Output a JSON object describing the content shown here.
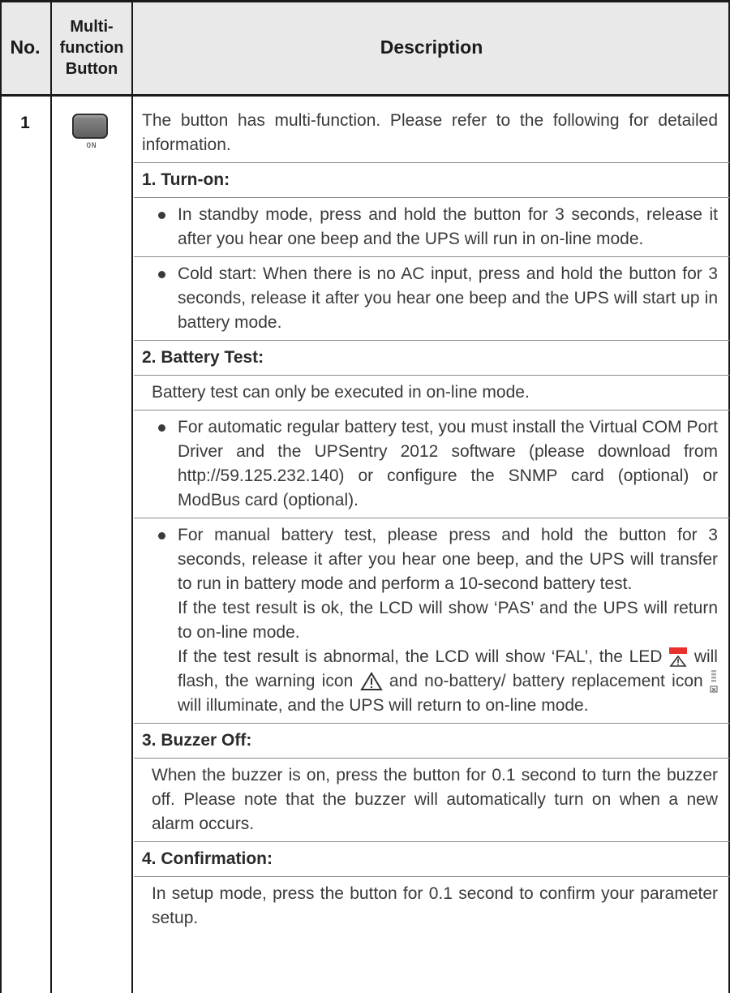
{
  "header": {
    "no": "No.",
    "button_line1": "Multi-",
    "button_line2": "function",
    "button_line3": "Button",
    "description": "Description"
  },
  "row": {
    "no": "1",
    "button_label": "ON",
    "intro": "The button has multi-function. Please refer to the following for detailed information.",
    "turn_on": {
      "heading": "1. Turn-on:",
      "bullets": [
        "In standby mode, press and hold the button for 3 seconds, release it after you hear one beep and the UPS will run in on-line mode.",
        "Cold start: When there is no AC input, press and hold the button for 3 seconds, release it after you hear one beep and the UPS will start up in battery mode."
      ]
    },
    "battery_test": {
      "heading": "2. Battery Test:",
      "intro": "Battery test can only be executed in on-line mode.",
      "bullets": [
        "For automatic regular battery test, you must install the Virtual COM Port Driver and the UPSentry 2012 software (please download from http://59.125.232.140) or configure the SNMP card (optional) or ModBus card (optional).",
        "For manual battery test, please press and hold the button for 3 seconds, release it after you hear one beep, and the UPS will transfer to run in battery mode and perform a 10-second battery test."
      ],
      "result_ok": "If the test result is ok, the LCD will show ‘PAS’ and the UPS will return to on-line mode.",
      "result_abnormal_1": "If the test result is abnormal, the LCD will show ‘FAL’, the LED",
      "result_abnormal_2": "will flash, the warning icon",
      "result_abnormal_3": "and no-battery/ battery replacement icon",
      "result_abnormal_4": "will illuminate, and the UPS will return to on-line mode."
    },
    "buzzer_off": {
      "heading": "3. Buzzer Off:",
      "text": "When the buzzer is on, press the button for 0.1 second to turn the buzzer off. Please note that the buzzer will automatically turn on when a new alarm occurs."
    },
    "confirmation": {
      "heading": "4. Confirmation:",
      "text": "In setup mode, press the button for 0.1 second to confirm your parameter setup."
    }
  },
  "colors": {
    "header_bg": "#e9e9e9",
    "border": "#1a1a1a",
    "text": "#3a3a3a",
    "led_red": "#e8312b"
  },
  "icons": [
    "multifunction-button-icon",
    "led-warning-icon",
    "warning-triangle-icon",
    "battery-replacement-icon"
  ]
}
